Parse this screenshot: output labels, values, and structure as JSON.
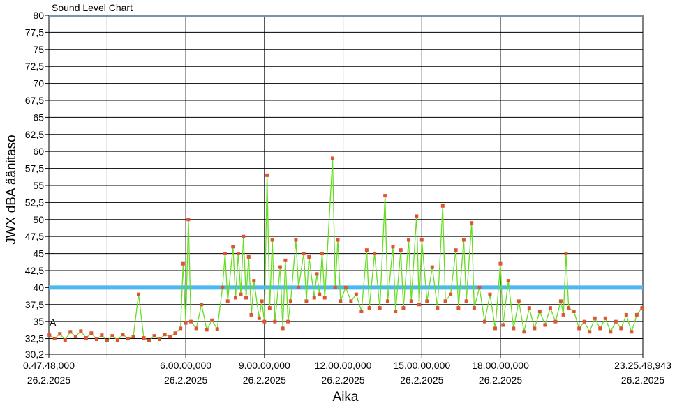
{
  "chart_data": {
    "type": "line",
    "title": "Sound Level Chart",
    "xlabel": "Aika",
    "ylabel": "JWX dBA äänitaso",
    "ylim": [
      30.2,
      80
    ],
    "xlim_hours": [
      0.78,
      23.43
    ],
    "y_ticks": [
      "30,2",
      "32,5",
      "35",
      "37,5",
      "40",
      "42,5",
      "45",
      "47,5",
      "50",
      "52,5",
      "55",
      "57,5",
      "60",
      "62,5",
      "65",
      "67,5",
      "70",
      "72,5",
      "75",
      "77,5",
      "80"
    ],
    "x_ticks": [
      {
        "hour": 0.78,
        "time": "0.47.48,000",
        "date": "26.2.2025"
      },
      {
        "hour": 6,
        "time": "6.00.00,000",
        "date": "26.2.2025"
      },
      {
        "hour": 9,
        "time": "9.00.00,000",
        "date": "26.2.2025"
      },
      {
        "hour": 12,
        "time": "12.00.00,000",
        "date": "26.2.2025"
      },
      {
        "hour": 15,
        "time": "15.00.00,000",
        "date": "26.2.2025"
      },
      {
        "hour": 18,
        "time": "18.00.00,000",
        "date": "26.2.2025"
      },
      {
        "hour": 23.43,
        "time": "23.25.48,943",
        "date": "26.2.2025"
      }
    ],
    "limit_line": {
      "value": 40,
      "color": "#4db8f0"
    },
    "max_line": {
      "value": 80,
      "color": "#7f8fb0"
    },
    "marker_label": "A",
    "series": [
      {
        "color": "#66dd22",
        "marker_color": "#dd5533",
        "points": [
          [
            0.8,
            33.0
          ],
          [
            1.0,
            32.5
          ],
          [
            1.2,
            33.2
          ],
          [
            1.4,
            32.3
          ],
          [
            1.6,
            33.5
          ],
          [
            1.8,
            32.8
          ],
          [
            2.0,
            33.6
          ],
          [
            2.2,
            32.6
          ],
          [
            2.4,
            33.3
          ],
          [
            2.6,
            32.4
          ],
          [
            2.8,
            33.0
          ],
          [
            3.0,
            32.2
          ],
          [
            3.2,
            32.9
          ],
          [
            3.4,
            32.3
          ],
          [
            3.6,
            33.1
          ],
          [
            3.8,
            32.5
          ],
          [
            4.0,
            32.8
          ],
          [
            4.2,
            39.0
          ],
          [
            4.4,
            32.6
          ],
          [
            4.6,
            32.2
          ],
          [
            4.8,
            32.9
          ],
          [
            5.0,
            32.4
          ],
          [
            5.2,
            33.1
          ],
          [
            5.4,
            32.8
          ],
          [
            5.6,
            33.3
          ],
          [
            5.8,
            34.0
          ],
          [
            5.9,
            43.5
          ],
          [
            6.0,
            34.8
          ],
          [
            6.1,
            50.0
          ],
          [
            6.2,
            35.0
          ],
          [
            6.4,
            34.0
          ],
          [
            6.6,
            37.5
          ],
          [
            6.8,
            33.8
          ],
          [
            7.0,
            35.2
          ],
          [
            7.2,
            33.9
          ],
          [
            7.4,
            40.0
          ],
          [
            7.5,
            45.0
          ],
          [
            7.6,
            38.0
          ],
          [
            7.8,
            46.0
          ],
          [
            7.9,
            38.5
          ],
          [
            8.0,
            45.0
          ],
          [
            8.1,
            39.0
          ],
          [
            8.2,
            47.5
          ],
          [
            8.3,
            38.5
          ],
          [
            8.4,
            44.5
          ],
          [
            8.5,
            36.0
          ],
          [
            8.6,
            41.0
          ],
          [
            8.8,
            35.5
          ],
          [
            8.9,
            38.0
          ],
          [
            9.0,
            35.0
          ],
          [
            9.1,
            56.5
          ],
          [
            9.2,
            37.0
          ],
          [
            9.3,
            47.0
          ],
          [
            9.4,
            35.0
          ],
          [
            9.6,
            43.0
          ],
          [
            9.7,
            34.0
          ],
          [
            9.8,
            44.0
          ],
          [
            9.9,
            35.0
          ],
          [
            10.0,
            38.0
          ],
          [
            10.2,
            47.0
          ],
          [
            10.3,
            40.0
          ],
          [
            10.5,
            45.0
          ],
          [
            10.6,
            38.0
          ],
          [
            10.7,
            44.5
          ],
          [
            10.9,
            38.5
          ],
          [
            11.0,
            42.0
          ],
          [
            11.1,
            39.0
          ],
          [
            11.2,
            45.0
          ],
          [
            11.3,
            38.5
          ],
          [
            11.6,
            59.0
          ],
          [
            11.7,
            40.0
          ],
          [
            11.8,
            47.0
          ],
          [
            11.9,
            38.0
          ],
          [
            12.1,
            40.0
          ],
          [
            12.3,
            38.0
          ],
          [
            12.5,
            39.0
          ],
          [
            12.7,
            36.5
          ],
          [
            12.9,
            45.5
          ],
          [
            13.0,
            37.0
          ],
          [
            13.2,
            45.0
          ],
          [
            13.4,
            37.0
          ],
          [
            13.6,
            53.5
          ],
          [
            13.7,
            38.0
          ],
          [
            13.9,
            46.0
          ],
          [
            14.0,
            36.5
          ],
          [
            14.2,
            45.5
          ],
          [
            14.3,
            37.0
          ],
          [
            14.5,
            47.0
          ],
          [
            14.6,
            38.0
          ],
          [
            14.8,
            50.5
          ],
          [
            14.9,
            37.5
          ],
          [
            15.0,
            47.0
          ],
          [
            15.2,
            38.0
          ],
          [
            15.4,
            43.0
          ],
          [
            15.6,
            37.0
          ],
          [
            15.8,
            52.0
          ],
          [
            15.9,
            38.0
          ],
          [
            16.1,
            39.0
          ],
          [
            16.3,
            45.5
          ],
          [
            16.4,
            37.0
          ],
          [
            16.6,
            47.0
          ],
          [
            16.7,
            38.0
          ],
          [
            16.9,
            49.5
          ],
          [
            17.0,
            37.0
          ],
          [
            17.2,
            40.0
          ],
          [
            17.4,
            35.0
          ],
          [
            17.6,
            39.0
          ],
          [
            17.8,
            34.0
          ],
          [
            18.0,
            43.5
          ],
          [
            18.1,
            34.5
          ],
          [
            18.3,
            41.0
          ],
          [
            18.5,
            34.0
          ],
          [
            18.7,
            38.0
          ],
          [
            18.9,
            33.5
          ],
          [
            19.1,
            37.0
          ],
          [
            19.3,
            34.0
          ],
          [
            19.5,
            36.5
          ],
          [
            19.7,
            34.5
          ],
          [
            19.9,
            37.0
          ],
          [
            20.1,
            35.0
          ],
          [
            20.3,
            38.0
          ],
          [
            20.4,
            36.0
          ],
          [
            20.5,
            45.0
          ],
          [
            20.6,
            37.0
          ],
          [
            20.8,
            36.5
          ],
          [
            21.0,
            34.0
          ],
          [
            21.2,
            35.0
          ],
          [
            21.4,
            33.5
          ],
          [
            21.6,
            35.5
          ],
          [
            21.8,
            34.0
          ],
          [
            22.0,
            35.5
          ],
          [
            22.2,
            33.5
          ],
          [
            22.4,
            35.0
          ],
          [
            22.6,
            34.0
          ],
          [
            22.8,
            36.0
          ],
          [
            23.0,
            33.5
          ],
          [
            23.2,
            36.0
          ],
          [
            23.4,
            37.0
          ]
        ]
      }
    ]
  }
}
